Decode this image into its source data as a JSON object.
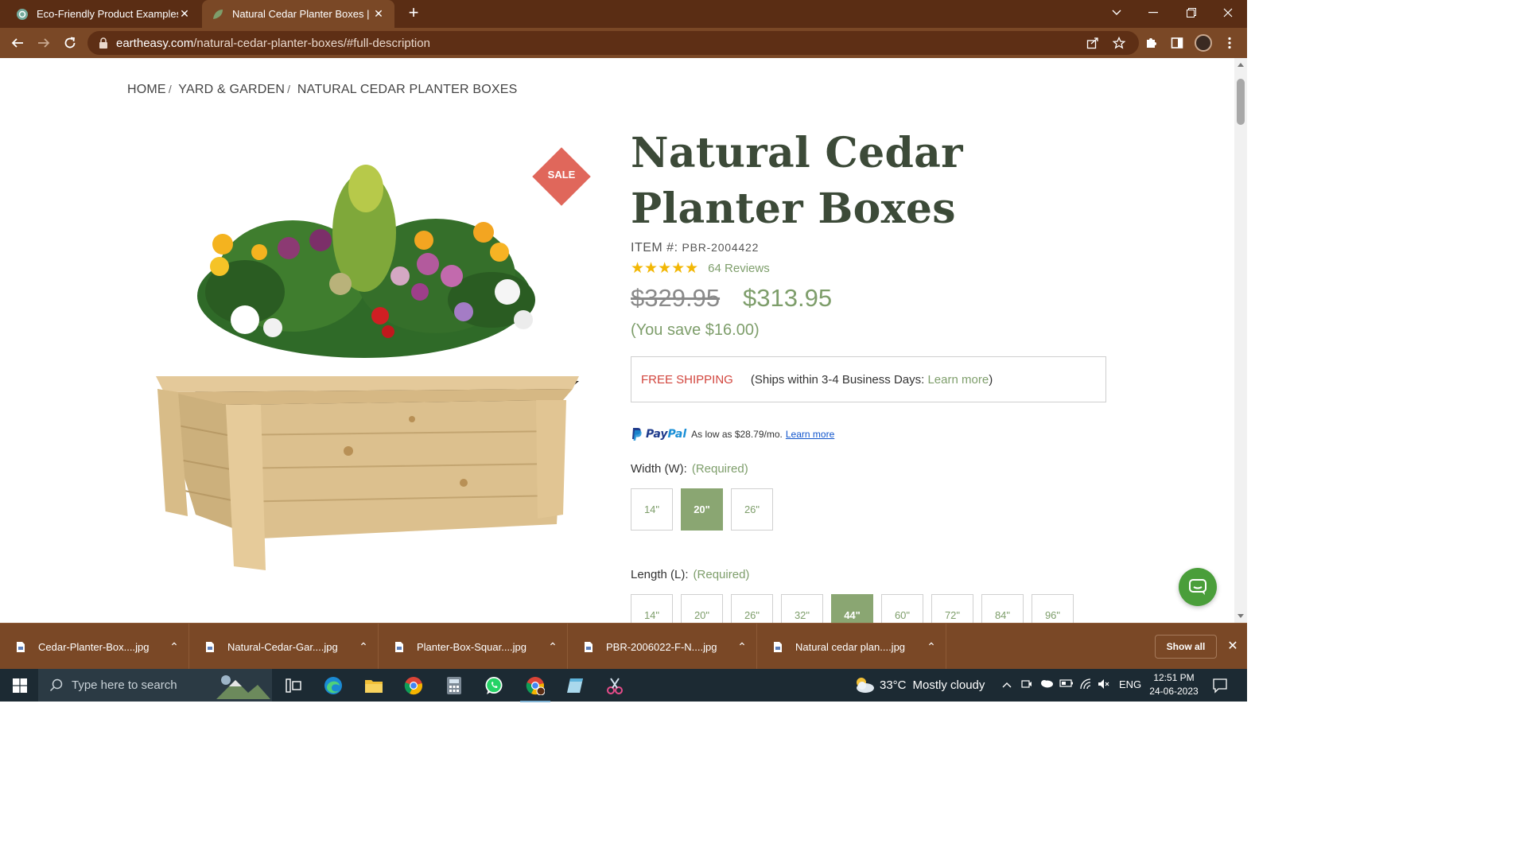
{
  "browser": {
    "tabs": [
      {
        "title": "Eco-Friendly Product Examples",
        "active": false
      },
      {
        "title": "Natural Cedar Planter Boxes | Ear",
        "active": true
      }
    ],
    "url_host": "eartheasy.com",
    "url_path": "/natural-cedar-planter-boxes/#full-description"
  },
  "page": {
    "breadcrumb": [
      "HOME",
      "YARD & GARDEN",
      "NATURAL CEDAR PLANTER BOXES"
    ],
    "breadcrumb_sep": "/",
    "sale_badge": "SALE",
    "title": "Natural Cedar Planter Boxes",
    "item_label": "ITEM #:",
    "item_code": "PBR-2004422",
    "stars": "★★★★★",
    "rating_value": 5,
    "reviews": "64 Reviews",
    "old_price": "$329.95",
    "new_price": "$313.95",
    "you_save": "(You save $16.00)",
    "shipping": {
      "label": "FREE SHIPPING",
      "info_prefix": "(Ships within 3-4 Business Days:",
      "link": "Learn more",
      "info_suffix": ")"
    },
    "paypal": {
      "brand_pay": "Pay",
      "brand_pal": "Pal",
      "text": "As low as $28.79/mo.",
      "link": "Learn more"
    },
    "width_option": {
      "label": "Width (W):",
      "required": "(Required)",
      "values": [
        "14\"",
        "20\"",
        "26\""
      ],
      "selected": "20\""
    },
    "length_option": {
      "label": "Length (L):",
      "required": "(Required)",
      "values": [
        "14\"",
        "20\"",
        "26\"",
        "32\"",
        "44\"",
        "60\"",
        "72\"",
        "84\"",
        "96\""
      ],
      "selected": "44\""
    }
  },
  "downloads": {
    "items": [
      "Cedar-Planter-Box....jpg",
      "Natural-Cedar-Gar....jpg",
      "Planter-Box-Squar....jpg",
      "PBR-2006022-F-N....jpg",
      "Natural cedar plan....jpg"
    ],
    "show_all": "Show all"
  },
  "taskbar": {
    "search_placeholder": "Type here to search",
    "weather_temp": "33°C",
    "weather_desc": "Mostly cloudy",
    "language": "ENG",
    "time": "12:51 PM",
    "date": "24-06-2023"
  },
  "colors": {
    "accent_green": "#7e9e6b",
    "selected_option": "#8aa672",
    "sale_red": "#e0675b",
    "free_shipping_red": "#d2453d",
    "chrome_brown": "#7a4826"
  }
}
